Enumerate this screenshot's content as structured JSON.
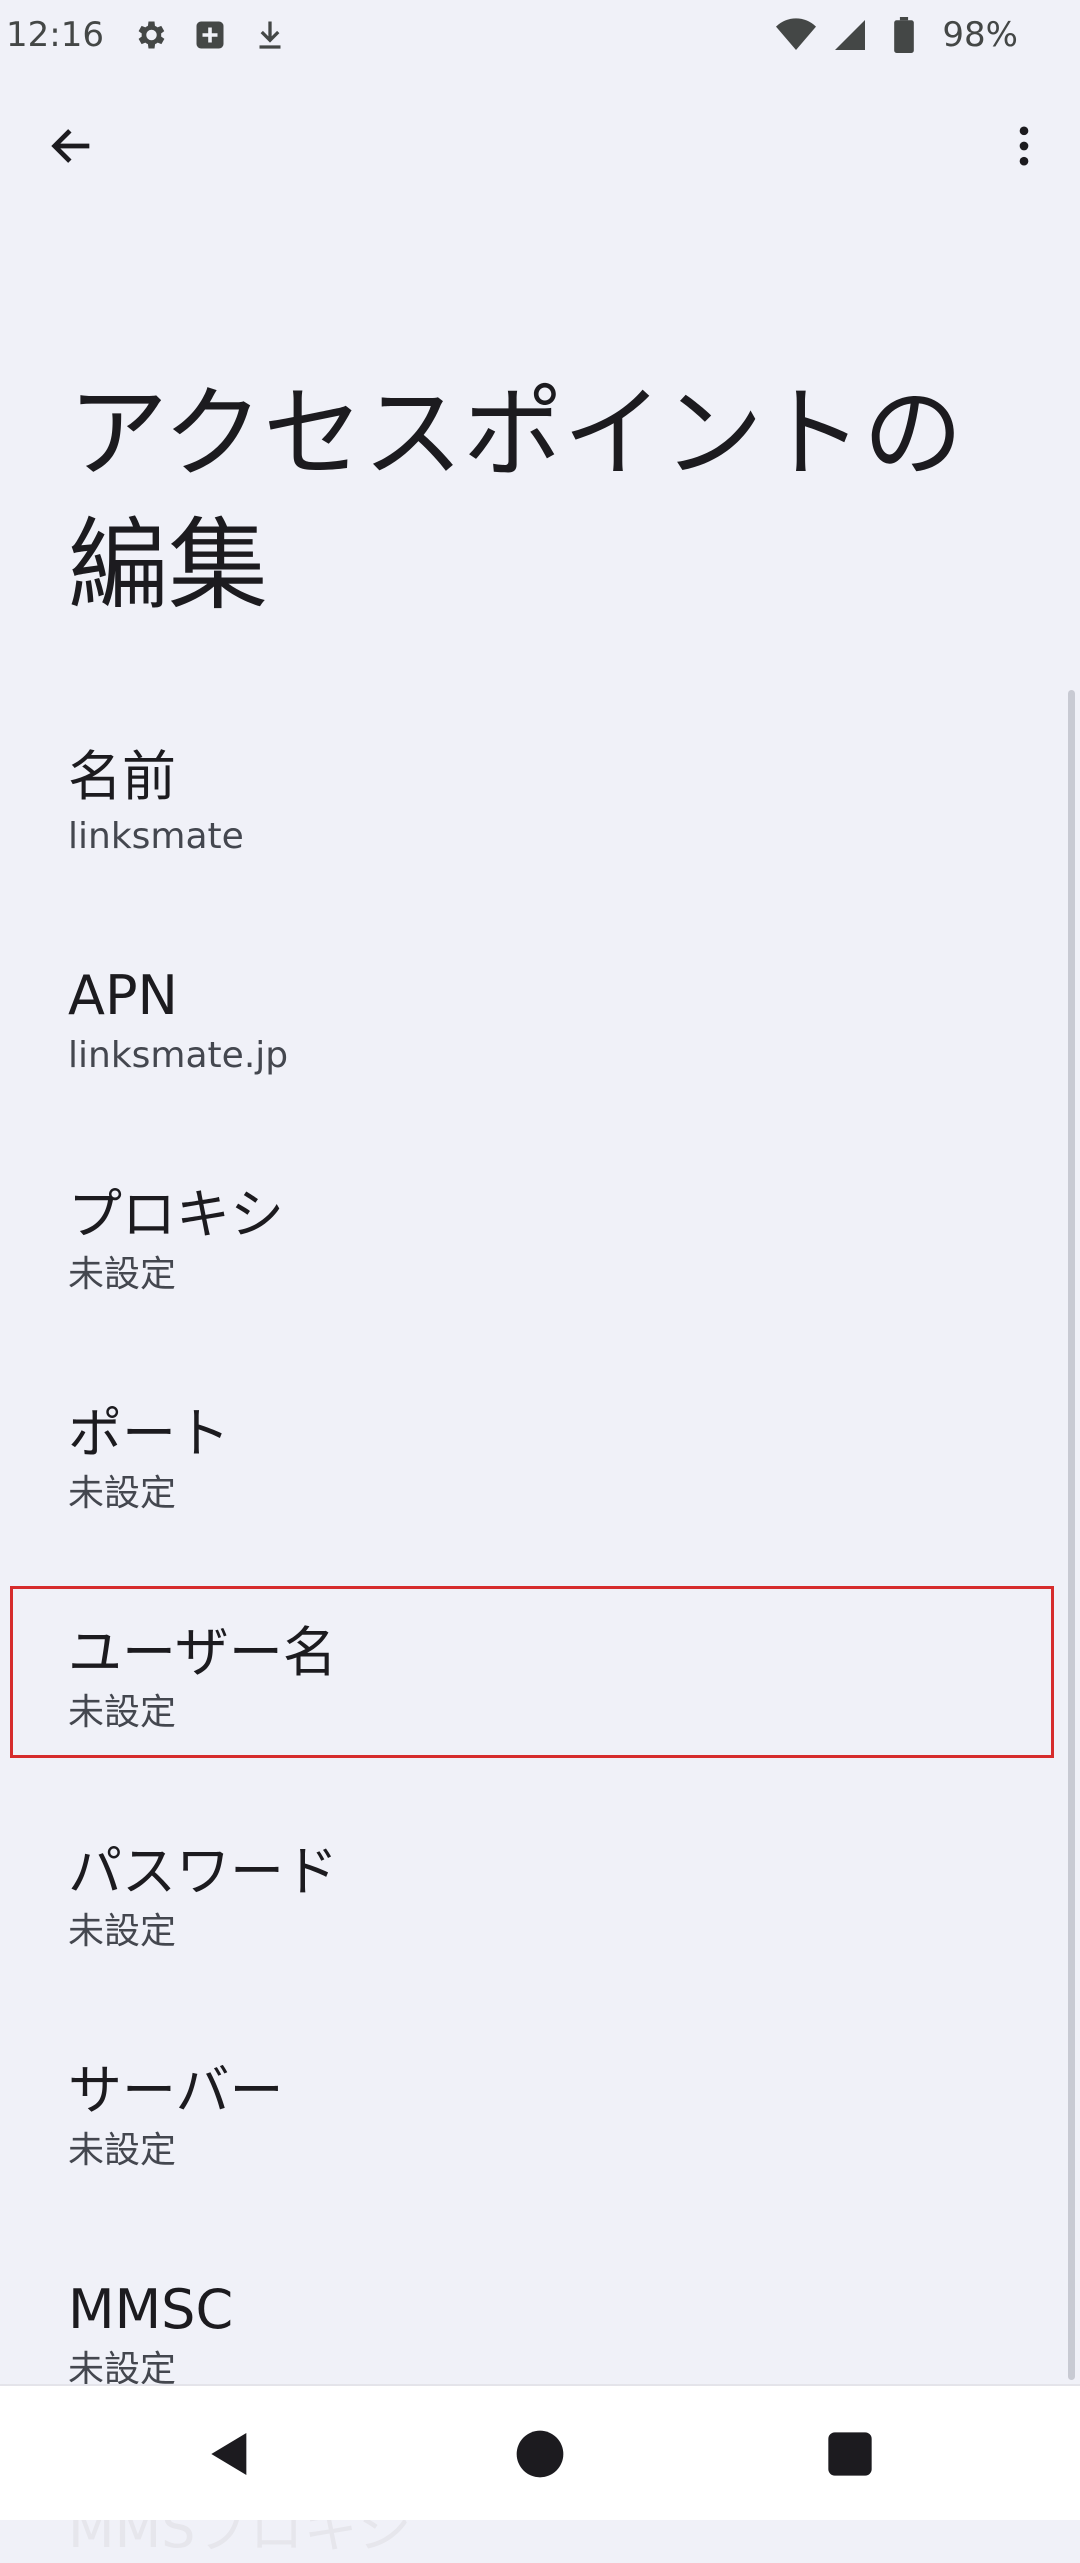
{
  "status_bar": {
    "time": "12:16",
    "battery": "98%",
    "icons": [
      "gear-icon",
      "plus-box-icon",
      "download-icon",
      "wifi-icon",
      "signal-icon",
      "battery-icon"
    ]
  },
  "top_bar": {
    "back_icon": "arrow-left-icon",
    "more_icon": "more-vert-icon"
  },
  "page": {
    "title_line1": "アクセスポイントの",
    "title_line2": "編集"
  },
  "settings": [
    {
      "title": "名前",
      "value": "linksmate"
    },
    {
      "title": "APN",
      "value": "linksmate.jp"
    },
    {
      "title": "プロキシ",
      "value": "未設定"
    },
    {
      "title": "ポート",
      "value": "未設定"
    },
    {
      "title": "ユーザー名",
      "value": "未設定"
    },
    {
      "title": "パスワード",
      "value": "未設定"
    },
    {
      "title": "サーバー",
      "value": "未設定"
    },
    {
      "title": "MMSC",
      "value": "未設定"
    }
  ],
  "next_item_partial": "MMSプロキシ",
  "colors": {
    "background": "#F0F1F8",
    "highlight": "#D62C2C",
    "text_primary": "#1C1B1F",
    "text_secondary": "#44474F"
  }
}
